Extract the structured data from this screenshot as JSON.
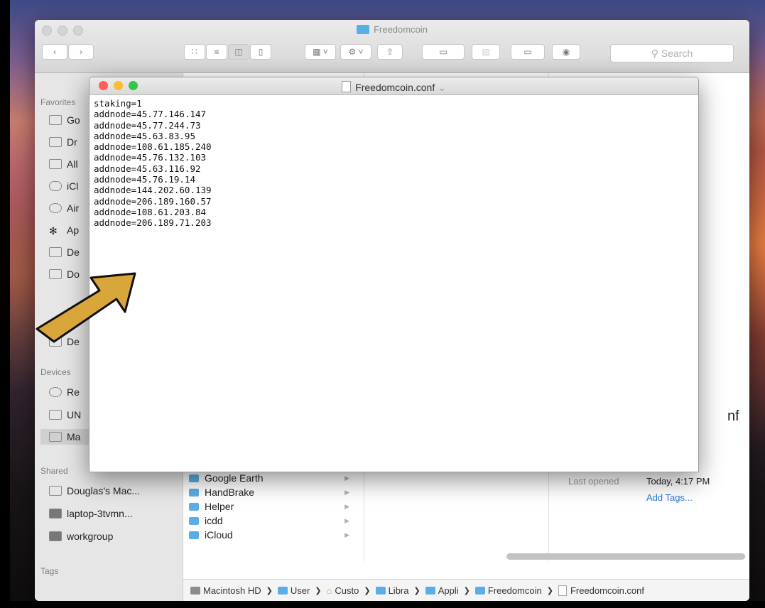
{
  "finder": {
    "title": "Freedomcoin",
    "search_placeholder": "Search",
    "sidebar": {
      "favorites_label": "Favorites",
      "favorites": [
        "Go",
        "Dr",
        "All",
        "iCl",
        "Air",
        "Ap",
        "De",
        "Do",
        "De"
      ],
      "devices_label": "Devices",
      "devices": [
        "Re",
        "UN",
        "Ma"
      ],
      "shared_label": "Shared",
      "shared": [
        "Douglas's Mac...",
        "laptop-3tvmn...",
        "workgroup"
      ],
      "tags_label": "Tags"
    },
    "column_items": [
      "Google Earth",
      "HandBrake",
      "Helper",
      "icdd",
      "iCloud"
    ],
    "preview": {
      "name_partial": "nf",
      "last_opened_label": "Last opened",
      "last_opened_value": "Today, 4:17 PM",
      "add_tags": "Add Tags..."
    },
    "path": [
      "Macintosh HD",
      "User",
      "Custo",
      "Libra",
      "Appli",
      "Freedomcoin",
      "Freedomcoin.conf"
    ]
  },
  "editor": {
    "title": "Freedomcoin.conf",
    "lines": [
      "staking=1",
      "addnode=45.77.146.147",
      "addnode=45.77.244.73",
      "addnode=45.63.83.95",
      "addnode=108.61.185.240",
      "addnode=45.76.132.103",
      "addnode=45.63.116.92",
      "addnode=45.76.19.14",
      "addnode=144.202.60.139",
      "addnode=206.189.160.57",
      "addnode=108.61.203.84",
      "addnode=206.189.71.203"
    ]
  },
  "colors": {
    "close": "#fc5f57",
    "minimize": "#fdbc2e",
    "zoom": "#33c748",
    "folder": "#5aaee8",
    "arrow": "#d9a63a"
  }
}
